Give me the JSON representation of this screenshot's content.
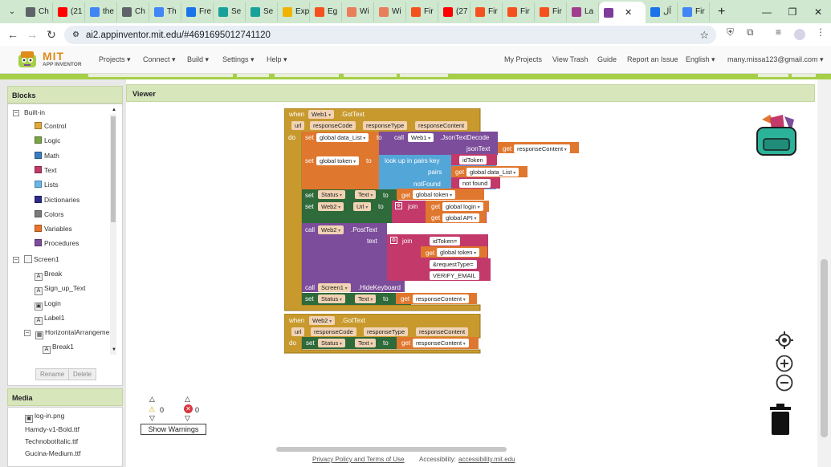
{
  "browser": {
    "tabs": [
      {
        "label": "Ch",
        "color": "#5f6368"
      },
      {
        "label": "(21",
        "color": "#ff0000"
      },
      {
        "label": "the",
        "color": "#4285f4"
      },
      {
        "label": "Ch",
        "color": "#5f6368"
      },
      {
        "label": "Th",
        "color": "#4285f4"
      },
      {
        "label": "Fre",
        "color": "#1a73e8"
      },
      {
        "label": "Se",
        "color": "#19a29a"
      },
      {
        "label": "Se",
        "color": "#19a29a"
      },
      {
        "label": "Exp",
        "color": "#f0b400"
      },
      {
        "label": "Eg",
        "color": "#f4511e"
      },
      {
        "label": "Wi",
        "color": "#e87e5a"
      },
      {
        "label": "Wi",
        "color": "#e87e5a"
      },
      {
        "label": "Fir",
        "color": "#f4511e"
      },
      {
        "label": "(27",
        "color": "#ff0000"
      },
      {
        "label": "Fir",
        "color": "#f4511e"
      },
      {
        "label": "Fir",
        "color": "#f4511e"
      },
      {
        "label": "Fir",
        "color": "#f4511e"
      },
      {
        "label": "La",
        "color": "#a23c8f"
      }
    ],
    "active_tab": {
      "label": "",
      "color": "#7e3b9b"
    },
    "after_tabs": [
      {
        "label": "آل",
        "color": "#1a73e8"
      },
      {
        "label": "Fir",
        "color": "#4285f4"
      }
    ],
    "url": "ai2.appinventor.mit.edu/#4691695012741120"
  },
  "app": {
    "logo_line1": "MIT",
    "logo_line2": "APP INVENTOR",
    "menu": [
      "Projects ▾",
      "Connect ▾",
      "Build ▾",
      "Settings ▾",
      "Help ▾"
    ],
    "right_menu": [
      "My Projects",
      "View Trash",
      "Guide",
      "Report an Issue",
      "English ▾",
      "many.missa123@gmail.com ▾"
    ]
  },
  "blocks_panel": {
    "title": "Blocks",
    "builtin_label": "Built-in",
    "builtin": [
      {
        "label": "Control",
        "color": "#e1a93b"
      },
      {
        "label": "Logic",
        "color": "#79a345"
      },
      {
        "label": "Math",
        "color": "#3a7cc0"
      },
      {
        "label": "Text",
        "color": "#c2396a"
      },
      {
        "label": "Lists",
        "color": "#68b7e8"
      },
      {
        "label": "Dictionaries",
        "color": "#2d2a8c"
      },
      {
        "label": "Colors",
        "color": "#7b7b7b"
      },
      {
        "label": "Variables",
        "color": "#e8752b"
      },
      {
        "label": "Procedures",
        "color": "#7c4d9a"
      }
    ],
    "screen_label": "Screen1",
    "components": [
      "Break",
      "Sign_up_Text",
      "Login",
      "Label1",
      "HorizontalArrangemen"
    ],
    "sub_component": "Break1",
    "rename": "Rename",
    "delete": "Delete"
  },
  "media_panel": {
    "title": "Media",
    "files": [
      "log-in.png",
      "Hamdy-v1-Bold.ttf",
      "TechnobotItalic.ttf",
      "Gucina-Medium.ttf"
    ]
  },
  "viewer": {
    "title": "Viewer",
    "warnings_count": "0",
    "errors_count": "0",
    "show_warnings": "Show Warnings"
  },
  "blocks": {
    "e1": {
      "when": "when",
      "component": "Web1",
      "event": ".GotText",
      "params": [
        "url",
        "responseCode",
        "responseType",
        "responseContent"
      ],
      "do": "do",
      "s1_set": "set",
      "s1_var": "global data_List",
      "s1_to": "to",
      "s1_call": "call",
      "s1_comp": "Web1",
      "s1_method": ".JsonTextDecode",
      "s1_arg": "jsonText",
      "s1_get": "get",
      "s1_getvar": "responseContent",
      "s2_set": "set",
      "s2_var": "global token",
      "s2_to": "to",
      "s2_lookup": "look up in pairs  key",
      "s2_key": "idToken",
      "s2_pairs": "pairs",
      "s2_get": "get",
      "s2_pairsvar": "global data_List",
      "s2_notfound": "notFound",
      "s2_nf_value": "not found",
      "s3_set": "set",
      "s3_comp": "Status",
      "s3_prop": "Text",
      "s3_to": "to",
      "s3_get": "get",
      "s3_var": "global token",
      "s4_set": "set",
      "s4_comp": "Web2",
      "s4_prop": "Url",
      "s4_to": "to",
      "s4_join": "join",
      "s4_get1": "get",
      "s4_var1": "global login",
      "s4_get2": "get",
      "s4_var2": "global API",
      "s5_call": "call",
      "s5_comp": "Web2",
      "s5_method": ".PostText",
      "s5_arg": "text",
      "s5_join": "join",
      "s5_t1": "idToken=",
      "s5_get": "get",
      "s5_var": "global token",
      "s5_t2": "&requestType=",
      "s5_t3": "VERIFY_EMAIL",
      "s6_call": "call",
      "s6_comp": "Screen1",
      "s6_method": ".HideKeyboard",
      "s7_set": "set",
      "s7_comp": "Status",
      "s7_prop": "Text",
      "s7_to": "to",
      "s7_get": "get",
      "s7_var": "responseContent"
    },
    "e2": {
      "when": "when",
      "component": "Web2",
      "event": ".GotText",
      "params": [
        "url",
        "responseCode",
        "responseType",
        "responseContent"
      ],
      "do": "do",
      "set": "set",
      "comp": "Status",
      "prop": "Text",
      "to": "to",
      "get": "get",
      "var": "responseContent"
    }
  },
  "footer": {
    "privacy": "Privacy Policy and Terms of Use",
    "accessibility_label": "Accessibility: ",
    "accessibility_link": "accessibility.mit.edu"
  }
}
